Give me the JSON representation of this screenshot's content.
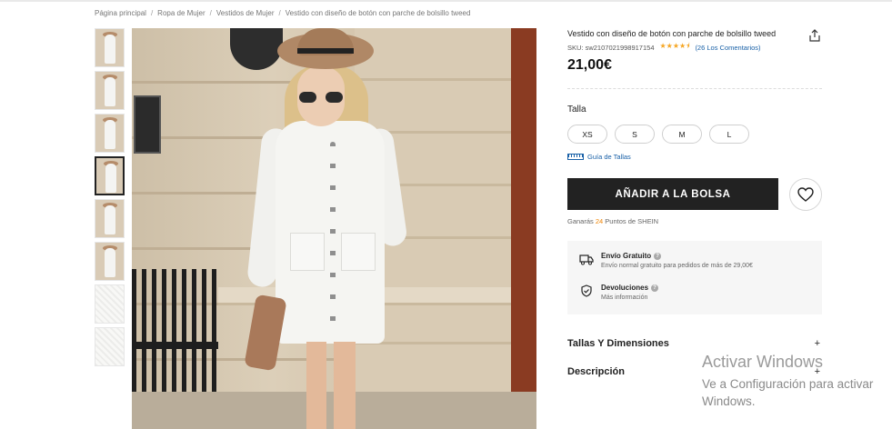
{
  "breadcrumb": {
    "items": [
      "Página principal",
      "Ropa de Mujer",
      "Vestidos de Mujer",
      "Vestido con diseño de botón con parche de bolsillo tweed"
    ],
    "separator": "/"
  },
  "gallery": {
    "thumbnail_count": 8,
    "active_index": 3
  },
  "product": {
    "title": "Vestido con diseño de botón con parche de bolsillo tweed",
    "sku_label": "SKU: sw2107021998917154",
    "rating": 4.5,
    "stars": "★★★★⯨",
    "reviews_label": "(26 Los Comentarios)",
    "price": "21,00€",
    "share_icon": "share-icon"
  },
  "size": {
    "title": "Talla",
    "options": [
      "XS",
      "S",
      "M",
      "L"
    ],
    "guide_label": "Guía de Tallas"
  },
  "actions": {
    "add_to_bag": "AÑADIR A LA BOLSA",
    "wishlist_icon": "heart-icon"
  },
  "points": {
    "prefix": "Ganarás ",
    "amount": "24",
    "suffix": " Puntos de SHEIN"
  },
  "shipping": {
    "free_title": "Envío Gratuito",
    "free_desc": "Envío normal gratuito para pedidos de más de 29,00€",
    "returns_title": "Devoluciones",
    "returns_desc": "Más información",
    "help_mark": "?"
  },
  "accordions": [
    {
      "label": "Tallas Y Dimensiones",
      "icon": "+"
    },
    {
      "label": "Descripción",
      "icon": "+"
    }
  ],
  "watermark": {
    "line1": "Activar Windows",
    "line2": "Ve a Configuración para activar",
    "line3": "Windows."
  },
  "colors": {
    "primary_button": "#222222",
    "link": "#1860a7",
    "points_accent": "#f08300",
    "star": "#f5a623"
  }
}
